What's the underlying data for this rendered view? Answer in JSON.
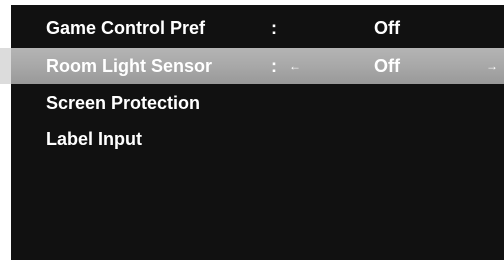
{
  "menu": {
    "items": [
      {
        "label": "Game Control Pref",
        "separator": ":",
        "value": "Off",
        "selected": false
      },
      {
        "label": "Room Light Sensor",
        "separator": ":",
        "value": "Off",
        "selected": true,
        "left_arrow": "←",
        "right_arrow": "→"
      },
      {
        "label": "Screen Protection"
      },
      {
        "label": "Label Input"
      }
    ]
  },
  "colors": {
    "background": "#111111",
    "text": "#ffffff",
    "selection": "#a8a8a8"
  }
}
